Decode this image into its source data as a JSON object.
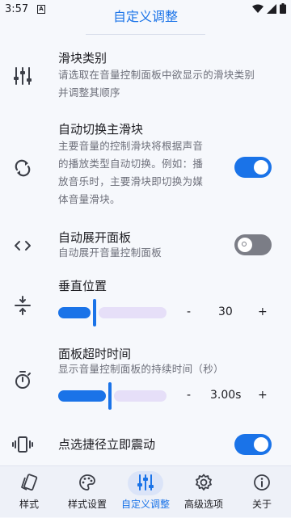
{
  "status_bar": {
    "time": "3:57",
    "app_badge": "A"
  },
  "header": {
    "title": "自定义调整"
  },
  "settings": {
    "slider_category": {
      "title": "滑块类别",
      "desc_line1": "请选取在音量控制面板中欲显示的滑块类别",
      "desc_line2": "并调整其顺序",
      "icon": "sliders-icon"
    },
    "auto_switch": {
      "title": "自动切换主滑块",
      "desc_line1": "主要音量的控制滑块将根据声音",
      "desc_line2": "的播放类型自动切换。例如：播",
      "desc_line3": "放音乐时，主要滑块即切换为媒",
      "desc_line4": "体音量滑块。",
      "enabled": true,
      "icon": "sync-icon"
    },
    "auto_expand": {
      "title": "自动展开面板",
      "desc": "自动展开音量控制面板",
      "enabled": false,
      "icon": "code-brackets-icon"
    },
    "vertical_position": {
      "title": "垂直位置",
      "value": "30",
      "fraction": 0.32,
      "minus": "-",
      "plus": "+",
      "icon": "vertical-align-center-icon"
    },
    "panel_timeout": {
      "title": "面板超时时间",
      "desc": "显示音量控制面板的持续时间（秒）",
      "value": "3.00s",
      "fraction": 0.46,
      "minus": "-",
      "plus": "+",
      "icon": "timer-icon"
    },
    "haptic_shortcut": {
      "title": "点选捷径立即震动",
      "enabled": true,
      "icon": "vibration-icon"
    }
  },
  "bottom_nav": {
    "items": [
      {
        "label": "样式",
        "icon": "style-cards-icon",
        "active": false
      },
      {
        "label": "样式设置",
        "icon": "palette-icon",
        "active": false
      },
      {
        "label": "自定义调整",
        "icon": "tune-sliders-icon",
        "active": true
      },
      {
        "label": "高级选项",
        "icon": "settings-gear-icon",
        "active": false
      },
      {
        "label": "关于",
        "icon": "info-icon",
        "active": false
      }
    ]
  },
  "colors": {
    "accent": "#1a73e8",
    "toggle_off": "#7b7d86",
    "slider_track": "#e6dff8",
    "background": "#f6f8fc"
  }
}
